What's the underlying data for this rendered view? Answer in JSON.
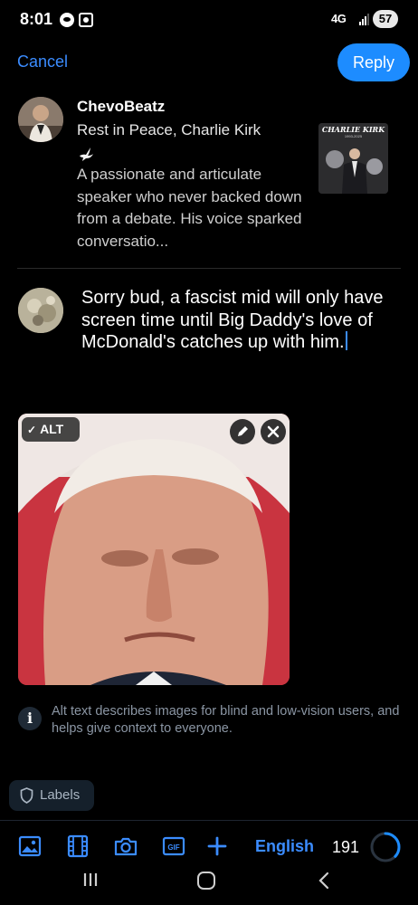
{
  "status_bar": {
    "time": "8:01",
    "network": "4G",
    "battery": "57"
  },
  "header": {
    "cancel_label": "Cancel",
    "reply_label": "Reply"
  },
  "quoted_post": {
    "author": "ChevoBeatz",
    "title": "Rest in Peace, Charlie Kirk",
    "body": "A passionate and articulate speaker who never backed down from a debate. His voice sparked conversatio...",
    "thumbnail_title": "CHARLIE KIRK",
    "thumbnail_subtitle": "1993-2025"
  },
  "composer": {
    "text": "Sorry bud, a fascist mid will only have screen time until Big Daddy's love of McDonald's catches up with him."
  },
  "attachment": {
    "alt_label": "ALT",
    "alt_set": true
  },
  "alt_info": {
    "text": "Alt text describes images for blind and low-vision users, and helps give context to everyone."
  },
  "labels_button": "Labels",
  "toolbar": {
    "icons": [
      "image-icon",
      "video-icon",
      "camera-icon",
      "gif-icon",
      "plus-icon"
    ],
    "gif_label": "GIF",
    "language": "English",
    "char_remaining": "191",
    "progress_fraction": 0.37
  },
  "colors": {
    "accent": "#1d8cff",
    "link": "#3b8cff",
    "background": "#000000",
    "muted_text": "#8b96a4"
  }
}
